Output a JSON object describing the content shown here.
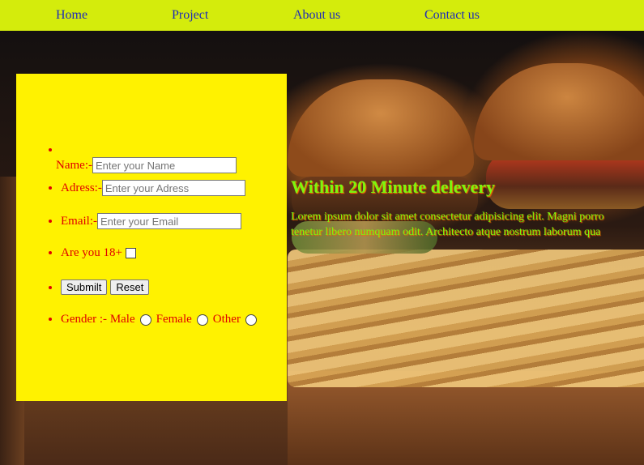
{
  "nav": {
    "items": [
      "Home",
      "Project",
      "About us",
      "Contact us"
    ]
  },
  "hero": {
    "heading": "Within 20 Minute delevery",
    "line1": "Lorem ipsum dolor sit amet consectetur adipisicing elit. Magni porro",
    "line2": "tenetur libero numquam odit. Architecto atque nostrum laborum qua"
  },
  "form": {
    "name_label": "Name:-",
    "name_placeholder": "Enter your Name",
    "address_label": "Adress:-",
    "address_placeholder": "Enter your Adress",
    "email_label": "Email:-",
    "email_placeholder": "Enter your Email",
    "age_label": "Are you 18+",
    "submit_label": "Submilt",
    "reset_label": "Reset",
    "gender_label": "Gender :- ",
    "gender_options": [
      "Male",
      "Female",
      "Other"
    ]
  },
  "colors": {
    "nav_bg": "#d4ec0c",
    "nav_link": "#1e2bb8",
    "panel_bg": "#fff200",
    "form_text": "#e00000",
    "hero_text": "#7cf60e"
  }
}
